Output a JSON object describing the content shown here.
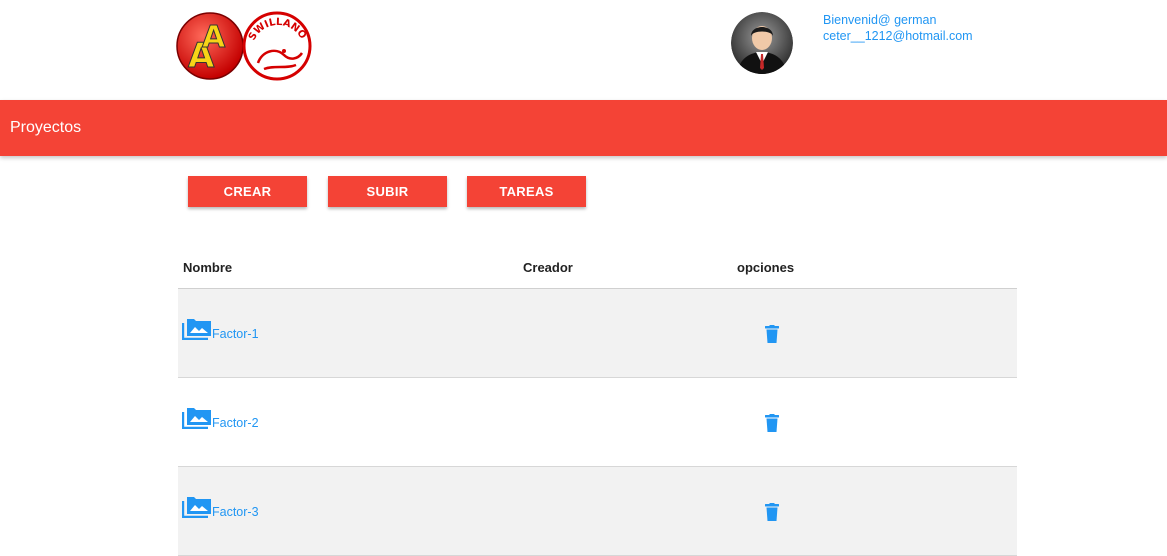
{
  "header": {
    "logo": {
      "name": "aa-swillanos-logo",
      "text": "SWILLANOS"
    },
    "user": {
      "greeting": "Bienvenid@ german",
      "email": "ceter__1212@hotmail.com"
    }
  },
  "navbar": {
    "title": "Proyectos"
  },
  "toolbar": {
    "crear_label": "CREAR",
    "subir_label": "SUBIR",
    "tareas_label": "TAREAS"
  },
  "table": {
    "columns": [
      "Nombre",
      "Creador",
      "opciones"
    ],
    "rows": [
      {
        "name": "Factor-1",
        "creator": "",
        "icon": "folder-image-icon",
        "action_icon": "trash-icon"
      },
      {
        "name": "Factor-2",
        "creator": "",
        "icon": "folder-image-icon",
        "action_icon": "trash-icon"
      },
      {
        "name": "Factor-3",
        "creator": "",
        "icon": "folder-image-icon",
        "action_icon": "trash-icon"
      }
    ]
  },
  "colors": {
    "primary": "#f44336",
    "link": "#2196f3",
    "row_shade": "#f2f2f2"
  }
}
